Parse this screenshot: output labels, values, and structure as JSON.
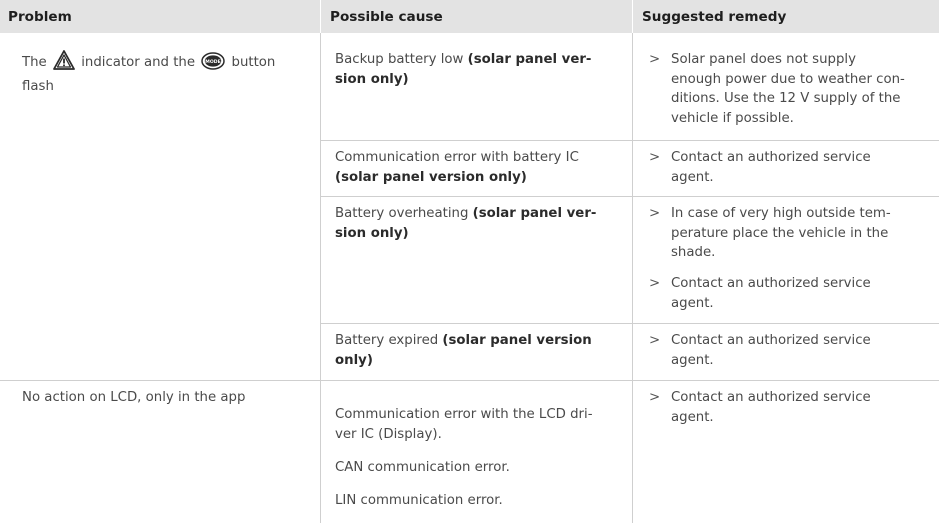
{
  "header": {
    "problem": "Problem",
    "cause": "Possible cause",
    "remedy": "Suggested remedy"
  },
  "row1": {
    "problem_a": "The",
    "problem_b": "indicator and the",
    "problem_c": "button",
    "problem_d": "flash",
    "mode_icon_text": "MODE",
    "cause1_a": "Backup battery low ",
    "cause1_b": "(solar panel ver-",
    "cause1_c": "sion only)",
    "remedy1": "Solar panel does not supply enough power due to weather con-ditions. Use the 12 V supply of the vehicle if possible.",
    "remedy1_lines": [
      "Solar panel does not supply",
      "enough power due to weather con-",
      "ditions. Use the 12 V supply of the",
      "vehicle if possible."
    ],
    "cause2_a": "Communication error with battery IC",
    "cause2_b": "(solar panel version only)",
    "remedy2_lines": [
      "Contact an authorized service",
      "agent."
    ],
    "cause3_a": "Battery overheating ",
    "cause3_b": "(solar panel ver-",
    "cause3_c": "sion only)",
    "remedy3a_lines": [
      "In case of very high outside tem-",
      "perature place the vehicle in the",
      "shade."
    ],
    "remedy3b_lines": [
      "Contact an authorized service",
      "agent."
    ],
    "cause4_a": "Battery expired ",
    "cause4_b": "(solar panel version",
    "cause4_c": "only)",
    "remedy4_lines": [
      "Contact an authorized service",
      "agent."
    ]
  },
  "row2": {
    "problem": "No action on LCD, only in the app",
    "cause_lines": [
      "Communication error with the LCD dri-",
      "ver IC (Display)."
    ],
    "cause2": "CAN communication error.",
    "cause3": "LIN communication error.",
    "remedy_lines": [
      "Contact an authorized service",
      "agent."
    ]
  },
  "bullet_marker": ">",
  "colors": {
    "header_bg": "#e3e3e3",
    "grid": "#cfcfcf",
    "text": "#4a4a4a"
  }
}
